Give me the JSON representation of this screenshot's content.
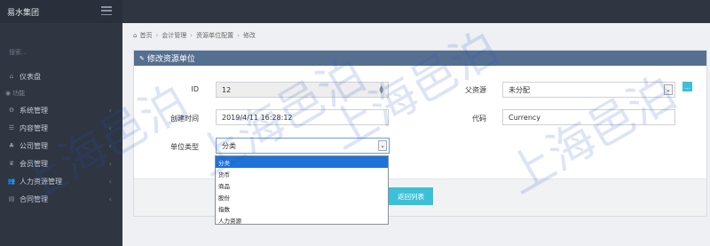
{
  "sidebar": {
    "brand": "易水集团",
    "search_placeholder": "搜索...",
    "items": [
      {
        "label": "仪表盘",
        "icon": "home-icon"
      },
      {
        "label": "功能",
        "icon": "globe-icon"
      },
      {
        "label": "系统管理",
        "icon": "gears-icon"
      },
      {
        "label": "内容管理",
        "icon": "list-icon"
      },
      {
        "label": "公司管理",
        "icon": "org-icon"
      },
      {
        "label": "会员管理",
        "icon": "trophy-icon"
      },
      {
        "label": "人力资源管理",
        "icon": "users-icon"
      },
      {
        "label": "合同管理",
        "icon": "contract-icon"
      }
    ]
  },
  "breadcrumb": [
    "首页",
    "会计管理",
    "资源单位配置",
    "修改"
  ],
  "panel": {
    "title": "修改资源单位",
    "fields": {
      "id_label": "ID",
      "id_value": "12",
      "parent_label": "父资源",
      "parent_value": "未分配",
      "created_label": "创建时间",
      "created_value": "2019/4/11 16:28:12",
      "code_label": "代码",
      "code_value": "Currency",
      "unit_type_label": "单位类型",
      "unit_type_value": "分类"
    },
    "dropdown_options": [
      "分类",
      "货币",
      "商品",
      "股份",
      "指数",
      "人力资源"
    ],
    "back_button": "返回列表"
  },
  "watermark": "上海邑泊",
  "colors": {
    "sidebar": "#2f3541",
    "panel_header": "#556f91",
    "accent": "#3cc0d8",
    "selected_option": "#1e72d8"
  }
}
